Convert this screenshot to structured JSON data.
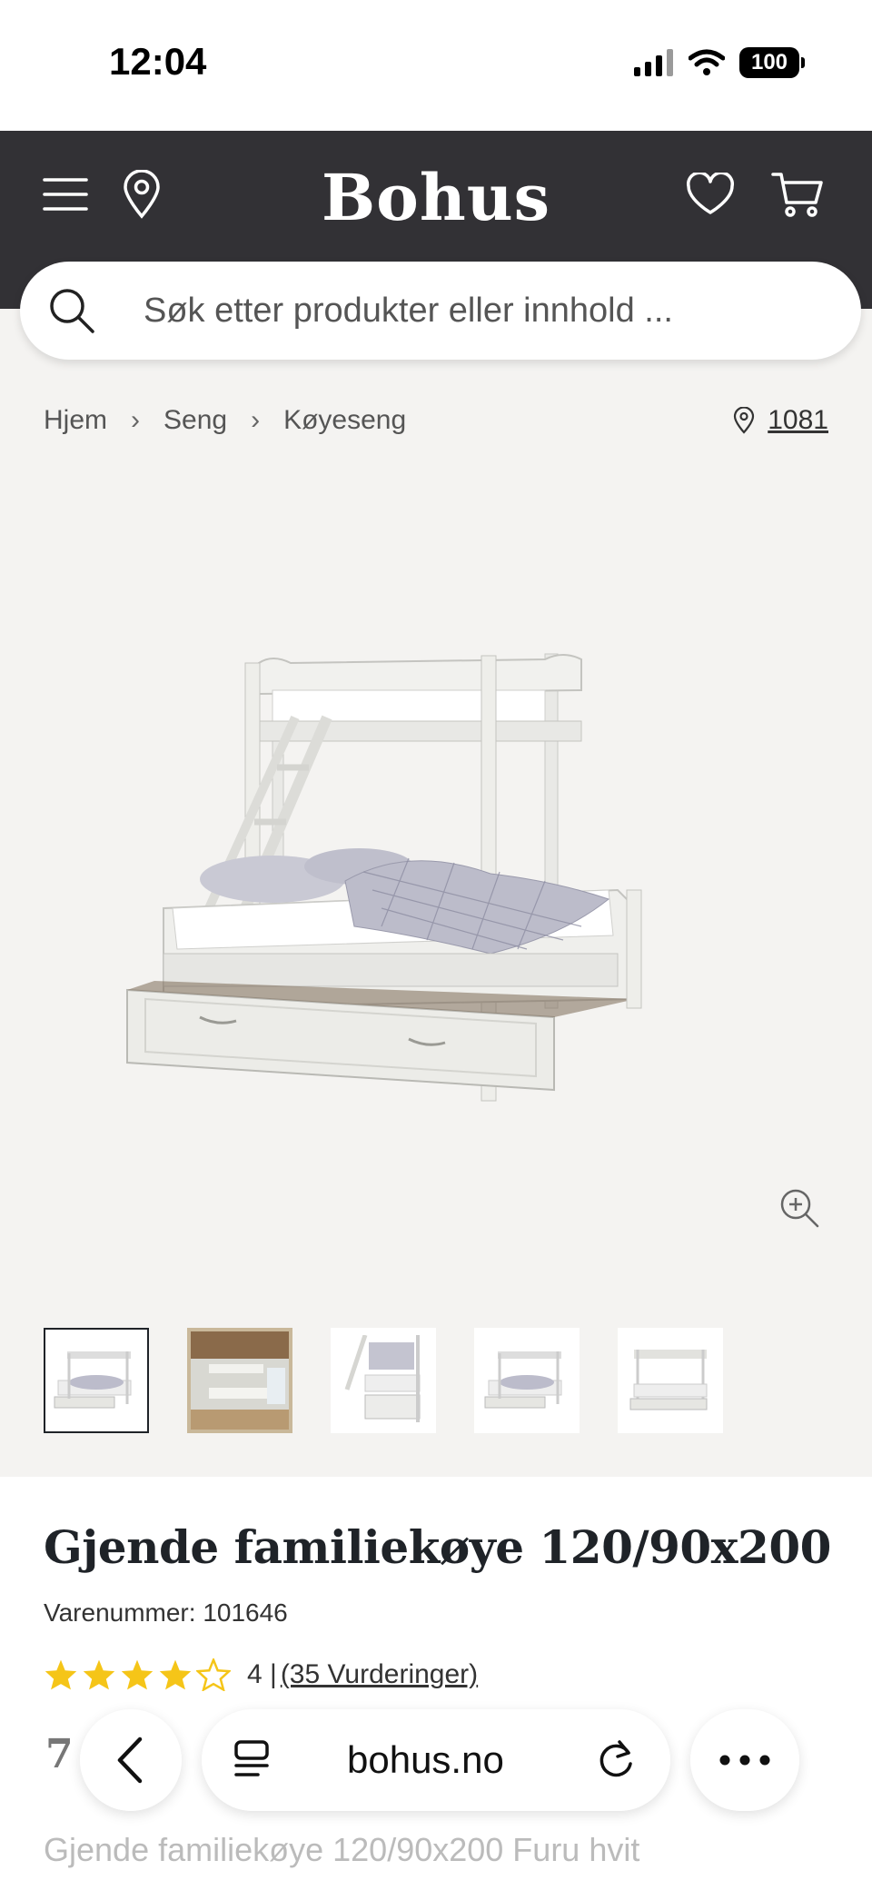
{
  "status_bar": {
    "time": "12:04",
    "battery": "100"
  },
  "header": {
    "logo": "Bohus",
    "search_placeholder": "Søk etter produkter eller innhold ..."
  },
  "breadcrumb": {
    "items": [
      "Hjem",
      "Seng",
      "Køyeseng"
    ],
    "store": "1081"
  },
  "product": {
    "title": "Gjende familiekøye 120/90x200",
    "sku": "Varenummer: 101646",
    "rating_value": 4,
    "rating_text": "4 |",
    "reviews": "(35 Vurderinger)",
    "price_partial": "7",
    "description_partial": "Gjende familiekøye 120/90x200 Furu hvit"
  },
  "gallery": {
    "thumbnail_count": 5,
    "active_index": 0
  },
  "browser": {
    "url": "bohus.no"
  },
  "colors": {
    "header_bg": "#323135",
    "star": "#f5c518",
    "page_bg": "#f4f3f1"
  }
}
